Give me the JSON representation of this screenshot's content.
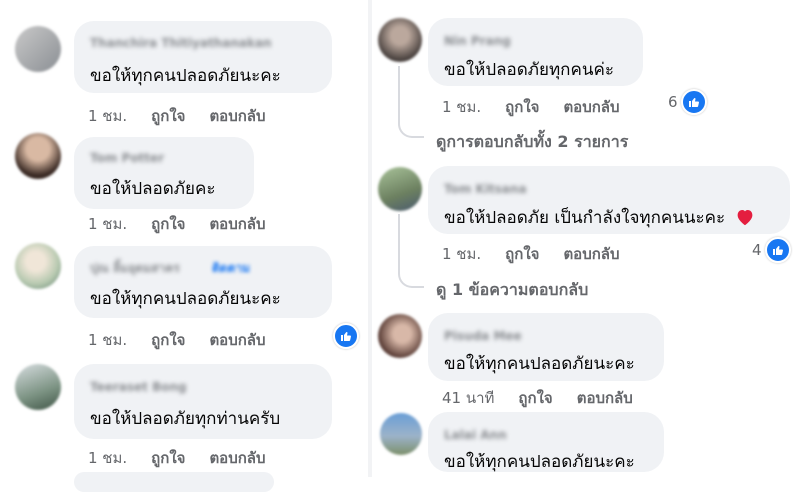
{
  "left": {
    "comments": [
      {
        "name": "Thanchira Thitiyathanakan",
        "text": "ขอให้ทุกคนปลอดภัยนะคะ",
        "time": "1 ชม.",
        "like": "ถูกใจ",
        "reply": "ตอบกลับ"
      },
      {
        "name": "Tom Potter",
        "text": "ขอให้ปลอดภัยคะ",
        "time": "1 ชม.",
        "like": "ถูกใจ",
        "reply": "ตอบกลับ"
      },
      {
        "name": "ปุณ ลิ้มอุดมสาคร",
        "follow": "ติดตาม",
        "text": "ขอให้ทุกคนปลอดภัยนะคะ",
        "time": "1 ชม.",
        "like": "ถูกใจ",
        "reply": "ตอบกลับ"
      },
      {
        "name": "Teeraset Bong",
        "text": "ขอให้ปลอดภัยทุกท่านครับ",
        "time": "1 ชม.",
        "like": "ถูกใจ",
        "reply": "ตอบกลับ"
      }
    ]
  },
  "right": {
    "comments": [
      {
        "name": "Nin Prang",
        "text": "ขอให้ปลอดภัยทุกคนค่ะ",
        "time": "1 ชม.",
        "like": "ถูกใจ",
        "reply": "ตอบกลับ",
        "reactions": "6",
        "view_replies": "ดูการตอบกลับทั้ง 2 รายการ"
      },
      {
        "name": "Tom Kitsana",
        "text": "ขอให้ปลอดภัย เป็นกำลังใจทุกคนนะคะ",
        "time": "1 ชม.",
        "like": "ถูกใจ",
        "reply": "ตอบกลับ",
        "reactions": "4",
        "view_replies": "ดู 1 ข้อความตอบกลับ"
      },
      {
        "name": "Pisuda Mee",
        "text": "ขอให้ทุกคนปลอดภัยนะคะ",
        "time": "41 นาที",
        "like": "ถูกใจ",
        "reply": "ตอบกลับ"
      },
      {
        "name": "Lalai Ann",
        "text": "ขอให้ทุกคนปลอดภัยนะคะ"
      }
    ]
  },
  "icons": {
    "reaction": "like-thumb-icon",
    "heart": "red-heart-emoji"
  },
  "colors": {
    "accent": "#1877f2",
    "bubble": "#f0f2f5",
    "meta": "#65676b",
    "heart": "#e41e3f"
  }
}
